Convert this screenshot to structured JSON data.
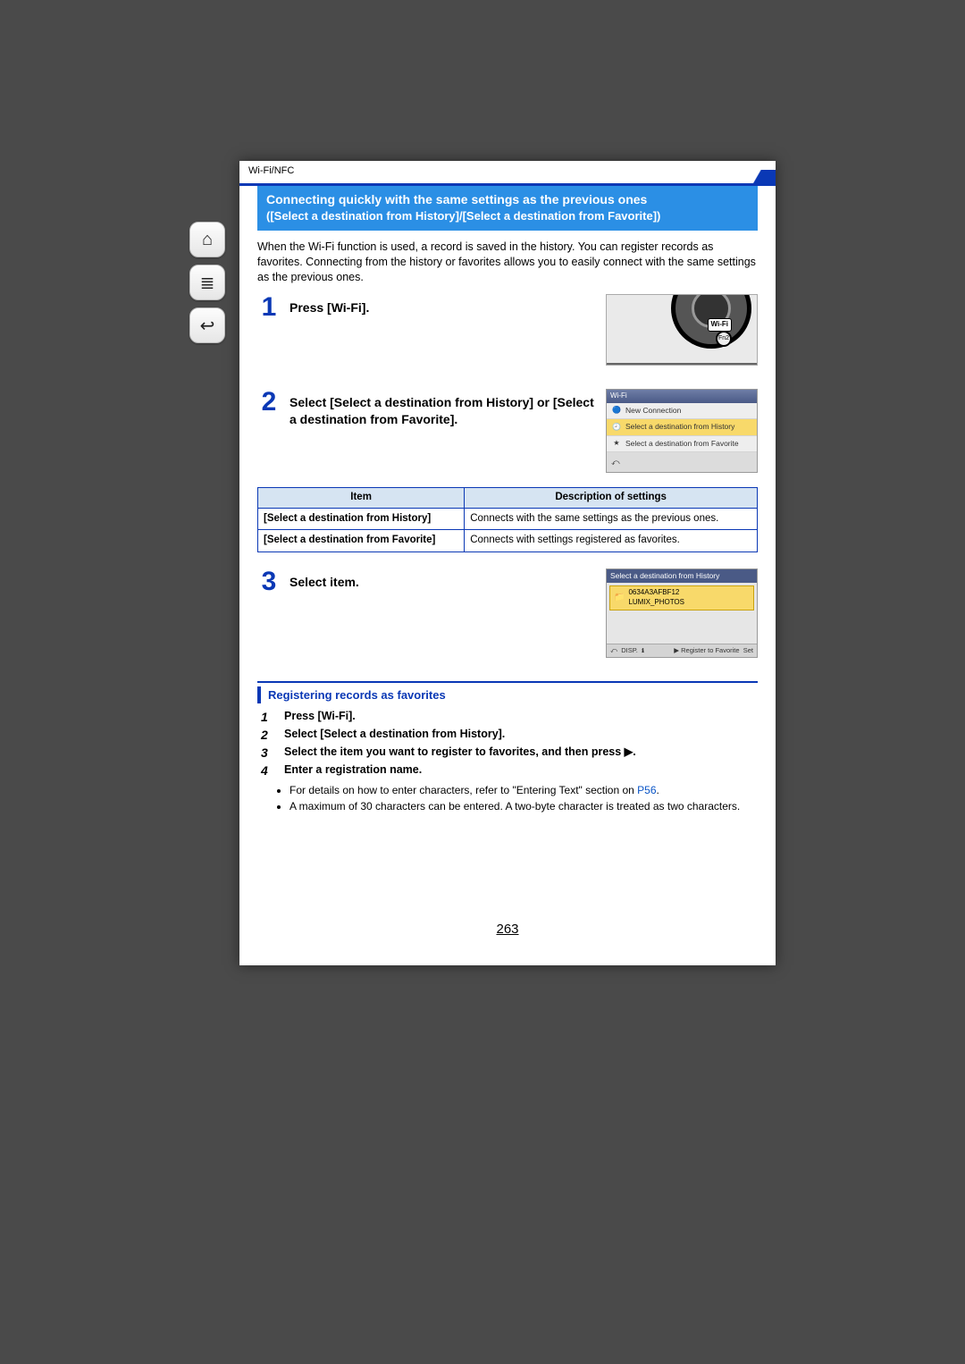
{
  "breadcrumb": "Wi-Fi/NFC",
  "nav": {
    "home": "⌂",
    "toc": "≣",
    "back": "↩"
  },
  "title": {
    "line1": "Connecting quickly with the same settings as the previous ones",
    "line2": "([Select a destination from History]/[Select a destination from Favorite])"
  },
  "intro": "When the Wi-Fi function is used, a record is saved in the history. You can register records as favorites. Connecting from the history or favorites allows you to easily connect with the same settings as the previous ones.",
  "steps": {
    "s1": {
      "num": "1",
      "text": "Press [Wi-Fi]."
    },
    "s2": {
      "num": "2",
      "text": "Select [Select a destination from History] or [Select a destination from Favorite]."
    },
    "s3": {
      "num": "3",
      "text": "Select item."
    }
  },
  "dial": {
    "wifi": "Wi-Fi",
    "fn": "Fn2"
  },
  "menu": {
    "header": "Wi-Fi",
    "items": [
      {
        "icon": "🔵",
        "label": "New Connection",
        "selected": false
      },
      {
        "icon": "🕘",
        "label": "Select a destination from History",
        "selected": true
      },
      {
        "icon": "★",
        "label": "Select a destination from Favorite",
        "selected": false
      }
    ],
    "footer_back": "⤺"
  },
  "table": {
    "head_item": "Item",
    "head_desc": "Description of settings",
    "rows": [
      {
        "k": "[Select a destination from History]",
        "v": "Connects with the same settings as the previous ones."
      },
      {
        "k": "[Select a destination from Favorite]",
        "v": "Connects with settings registered as favorites."
      }
    ]
  },
  "history_screen": {
    "header": "Select a destination from History",
    "item_code": "0634A3AFBF12",
    "item_name": "LUMIX_PHOTOS",
    "foot_back": "⤺",
    "foot_disp": "DISP.",
    "foot_info": "ℹ",
    "foot_reg": "▶ Register to Favorite",
    "foot_set": "Set"
  },
  "subsection": {
    "heading": "Registering records as favorites",
    "steps": [
      "Press [Wi-Fi].",
      "Select [Select a destination from History].",
      "Select the item you want to register to favorites, and then press ▶.",
      "Enter a registration name."
    ],
    "bullets": [
      {
        "pre": "For details on how to enter characters, refer to \"Entering Text\" section on ",
        "ref": "P56",
        "post": "."
      },
      {
        "pre": "A maximum of 30 characters can be entered. A two-byte character is treated as two characters.",
        "ref": "",
        "post": ""
      }
    ]
  },
  "page_number": "263"
}
